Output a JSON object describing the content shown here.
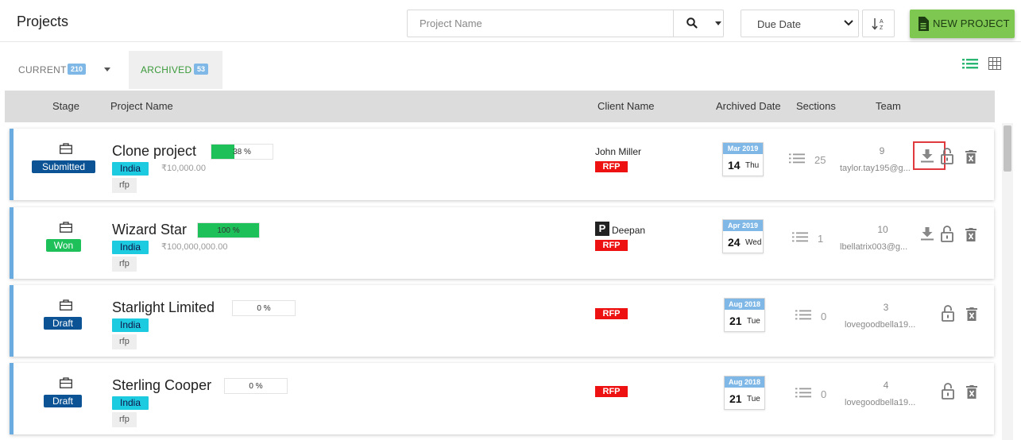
{
  "header": {
    "title": "Projects",
    "search_placeholder": "Project Name",
    "sort_label": "Due Date",
    "new_project_label": "NEW PROJECT"
  },
  "tabs": {
    "current": {
      "label": "CURRENT",
      "count": "210"
    },
    "archived": {
      "label": "ARCHIVED",
      "count": "53"
    }
  },
  "columns": {
    "stage": "Stage",
    "project_name": "Project Name",
    "client_name": "Client Name",
    "archived_date": "Archived Date",
    "sections": "Sections",
    "team": "Team"
  },
  "colors": {
    "accent_blue": "#6aace0",
    "new_project_green": "#7ec852",
    "progress_green": "#1ec05a",
    "rfp_red": "#ee1111",
    "stage_submitted": "#0b5394",
    "stage_won": "#1ec05a",
    "stage_draft": "#0b5394"
  },
  "projects": [
    {
      "stage": "Submitted",
      "name": "Clone project",
      "progress_percent": 38,
      "progress_label": "38 %",
      "country": "India",
      "amount": "₹10,000.00",
      "tag": "rfp",
      "client": "John Miller",
      "client_logo": "",
      "type": "RFP",
      "date": {
        "month": "Mar 2019",
        "day": "14",
        "weekday": "Thu"
      },
      "sections": "25",
      "team_count": "9",
      "team_email": "taylor.tay195@g..."
    },
    {
      "stage": "Won",
      "name": "Wizard Star",
      "progress_percent": 100,
      "progress_label": "100 %",
      "country": "India",
      "amount": "₹100,000,000.00",
      "tag": "rfp",
      "client": "Deepan",
      "client_logo": "P",
      "type": "RFP",
      "date": {
        "month": "Apr 2019",
        "day": "24",
        "weekday": "Wed"
      },
      "sections": "1",
      "team_count": "10",
      "team_email": "lbellatrix003@g..."
    },
    {
      "stage": "Draft",
      "name": "Starlight Limited",
      "progress_percent": 0,
      "progress_label": "0 %",
      "country": "India",
      "amount": "",
      "tag": "rfp",
      "client": "",
      "client_logo": "",
      "type": "RFP",
      "date": {
        "month": "Aug 2018",
        "day": "21",
        "weekday": "Tue"
      },
      "sections": "0",
      "team_count": "3",
      "team_email": "lovegoodbella19..."
    },
    {
      "stage": "Draft",
      "name": "Sterling Cooper",
      "progress_percent": 0,
      "progress_label": "0 %",
      "country": "India",
      "amount": "",
      "tag": "rfp",
      "client": "",
      "client_logo": "",
      "type": "RFP",
      "date": {
        "month": "Aug 2018",
        "day": "21",
        "weekday": "Tue"
      },
      "sections": "0",
      "team_count": "4",
      "team_email": "lovegoodbella19..."
    }
  ]
}
